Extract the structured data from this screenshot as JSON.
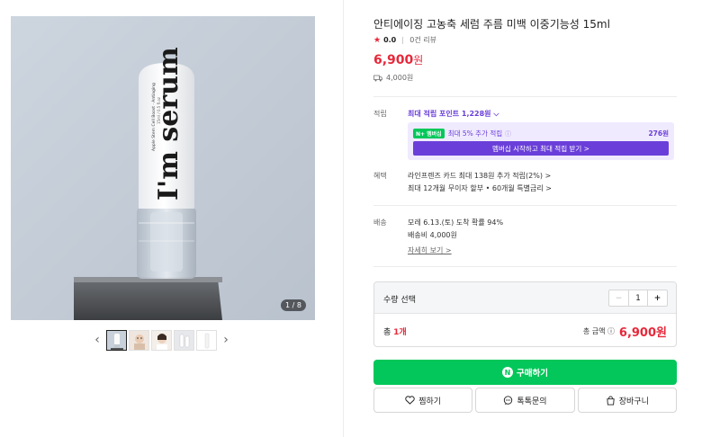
{
  "product": {
    "title": "안티에이징 고농축 세럼 주름 미백 이중기능성 15ml",
    "rating_score": "0.0",
    "review_count": "0건 리뷰",
    "price_value": "6,900",
    "price_unit": "원",
    "shipping_fee": "4,000원"
  },
  "gallery": {
    "counter": "1 / 8",
    "bottle_text": "I'm serum",
    "thumbnail_count": 5,
    "active_thumbnail": 1
  },
  "points": {
    "label": "적립",
    "max_points": "최대 적립 포인트 1,228원 ⌵",
    "npay_badge": "N+ 멤버십",
    "extra_text": "최대 5% 추가 적립",
    "extra_value": "276원",
    "membership_button": "멤버십 시작하고 최대 적립 받기 >"
  },
  "benefits": {
    "label": "혜택",
    "card": "라인프렌즈 카드 최대 138원 추가 적립(2%) >",
    "installment": "최대 12개월 무이자 할부 • 60개월 특별금리 >"
  },
  "delivery": {
    "label": "배송",
    "arrival": "모레 6.13.(토) 도착 확률 94%",
    "fee": "배송비 4,000원",
    "detail_link": "자세히 보기 >"
  },
  "quantity": {
    "label": "수량 선택",
    "minus": "−",
    "value": "1",
    "plus": "+",
    "total_prefix": "총 ",
    "total_count": "1개",
    "total_price_label": "총 금액 ⓘ",
    "total_price": "6,900원"
  },
  "actions": {
    "buy": "구매하기",
    "wishlist": "찜하기",
    "talk": "톡톡문의",
    "cart": "장바구니"
  },
  "colors": {
    "accent_red": "#e6283a",
    "npay_green": "#03c75a",
    "membership_purple": "#6a3fd9"
  }
}
